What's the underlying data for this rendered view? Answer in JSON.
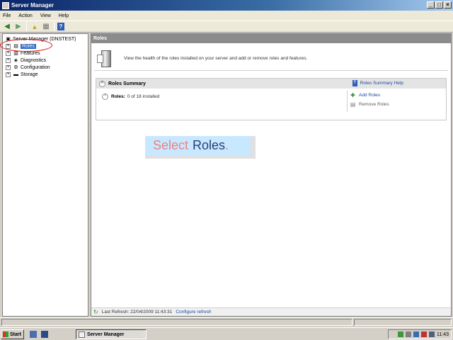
{
  "window": {
    "title": "Server Manager"
  },
  "menu": [
    "File",
    "Action",
    "View",
    "Help"
  ],
  "tree": {
    "root": "Server Manager (DNSTEST)",
    "items": [
      "Roles",
      "Features",
      "Diagnostics",
      "Configuration",
      "Storage"
    ],
    "selected": "Roles"
  },
  "content": {
    "header": "Roles",
    "description": "View the health of the roles installed on your server and add or remove roles and features.",
    "summary": {
      "title": "Roles Summary",
      "help_link": "Roles Summary Help",
      "roles_label": "Roles:",
      "roles_value": "0 of 18 installed",
      "add_roles": "Add Roles",
      "remove_roles": "Remove Roles"
    },
    "instruction": {
      "word1": "Select",
      "word2": "Roles",
      "punct": "."
    },
    "refresh": {
      "text": "Last Refresh: 22/04/2009 11:43:31",
      "link": "Configure refresh"
    }
  },
  "taskbar": {
    "start": "Start",
    "task": "Server Manager",
    "clock": "11:43"
  },
  "colors": {
    "title_bar": "#0a246a",
    "selection": "#316ac5",
    "link": "#1a4ba0",
    "annotation": "#e01010",
    "tooltip_bg": "#c8e8ff"
  }
}
